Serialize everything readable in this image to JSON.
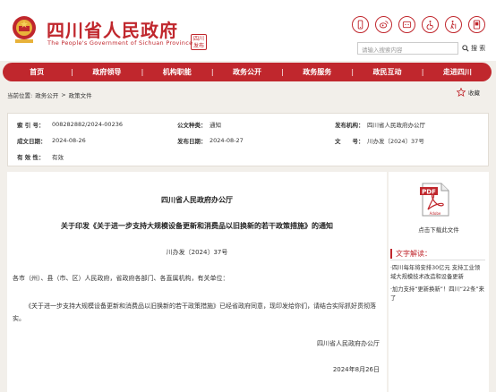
{
  "header": {
    "title": "四川省人民政府",
    "subtitle": "The People's Government of Sichuan Province",
    "mini_logo": "四川\n发布",
    "icons": [
      "mobile-icon",
      "weibo-icon",
      "wechat-icon",
      "accessibility-icon",
      "elderly-mode-icon",
      "app-icon"
    ],
    "search_placeholder": "请输入搜索内容",
    "search_label": "搜 索"
  },
  "nav": {
    "items": [
      "首页",
      "政府领导",
      "机构职能",
      "政务公开",
      "政务服务",
      "政民互动",
      "走进四川"
    ]
  },
  "breadcrumb": {
    "current_label": "当前位置:",
    "items": [
      "政务公开",
      "政策文件"
    ],
    "sep": ">",
    "favorite": "收藏"
  },
  "info": {
    "index_label": "索 引 号：",
    "index_value": "008282882/2024-00236",
    "category_label": "公文种类：",
    "category_value": "通知",
    "issuer_label": "发布机构：",
    "issuer_value": "四川省人民政府办公厅",
    "created_label": "成文日期：",
    "created_value": "2024-08-26",
    "published_label": "发布日期：",
    "published_value": "2024-08-27",
    "docno_label": "文　　号：",
    "docno_value": "川办发〔2024〕37号",
    "validity_label": "有 效 性：",
    "validity_value": "有效"
  },
  "doc": {
    "org": "四川省人民政府办公厅",
    "title": "关于印发《关于进一步支持大规模设备更新和消费品以旧换新的若干政策措施》的通知",
    "number": "川办发〔2024〕37号",
    "to": "各市（州）、县（市、区）人民政府，省政府各部门、各直属机构，有关单位：",
    "body": "《关于进一步支持大规模设备更新和消费品以旧换新的若干政策措施》已经省政府同意，现印发给你们，请结合实际抓好贯彻落实。",
    "signature": "四川省人民政府办公厅",
    "date": "2024年8月26日"
  },
  "side": {
    "pdf_label": "点击下载此文件",
    "related_heading": "文字解读：",
    "related_items": [
      "·四川每年将安排30亿元 支持工业领域大规模技术改造和设备更新",
      "·加力支持“更新换新”！四川“22条”来了"
    ]
  },
  "colors": {
    "brand_red": "#c0272d",
    "page_bg": "#f2efea"
  }
}
